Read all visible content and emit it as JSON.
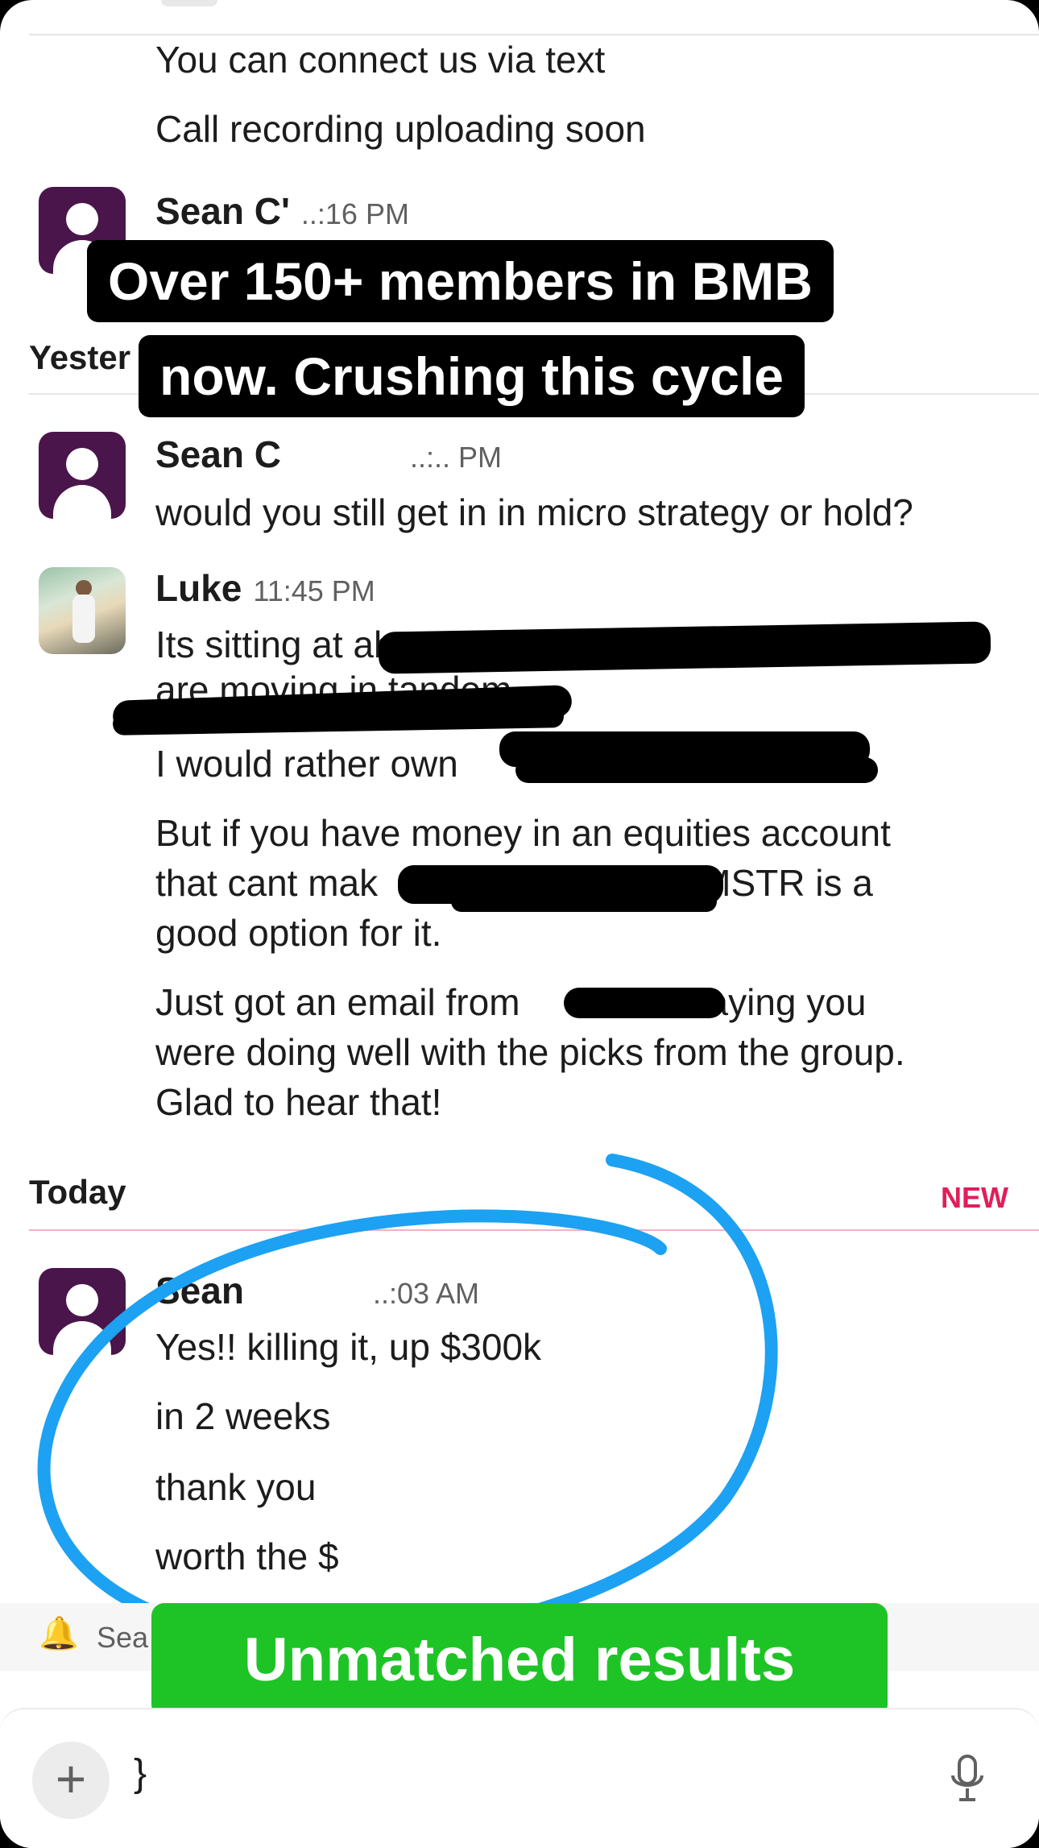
{
  "top_messages": [
    "You can connect us via text",
    "Call recording uploading soon"
  ],
  "msg_sean1": {
    "name": "Sean C'",
    "time": "..:16 PM"
  },
  "overlay_caption": {
    "line1": "Over 150+ members in BMB",
    "line2": "now. Crushing this cycle"
  },
  "divider_yesterday": "Yester",
  "msg_sean2": {
    "name": "Sean C",
    "time": "..:.. PM",
    "text": "would you still get in in micro strategy or hold?"
  },
  "msg_luke": {
    "name": "Luke",
    "time": "11:45 PM",
    "line1": "Its sitting at ab",
    "line2": "are moving in tandem",
    "line3": "I would rather own",
    "p2_line1": "But if you have money in an equities account",
    "p2_line2a": "that cant mak",
    "p2_line2b": "MSTR is a",
    "p2_line3": "good option for it.",
    "p3_line1a": "Just got an email from",
    "p3_line1b": "saying you",
    "p3_line2": "were doing well with the picks from the group.",
    "p3_line3": "Glad to hear that!"
  },
  "divider_today": {
    "label": "Today",
    "new_badge": "NEW"
  },
  "msg_sean3": {
    "name": "Sean",
    "time": "..:03 AM",
    "lines": [
      "Yes!! killing it, up $300k",
      "in 2 weeks",
      "thank you",
      "worth the $"
    ]
  },
  "notify_bar": {
    "text": "Sea"
  },
  "green_caption": "Unmatched results",
  "composer": {
    "input_value": "}"
  },
  "colors": {
    "avatar": "#4a154b",
    "new_badge": "#e01e5a",
    "circle": "#1da1f2",
    "green": "#1ec426"
  },
  "icons": {
    "plus": "plus-icon",
    "mic": "microphone-icon",
    "bell": "bell-snooze-icon"
  }
}
